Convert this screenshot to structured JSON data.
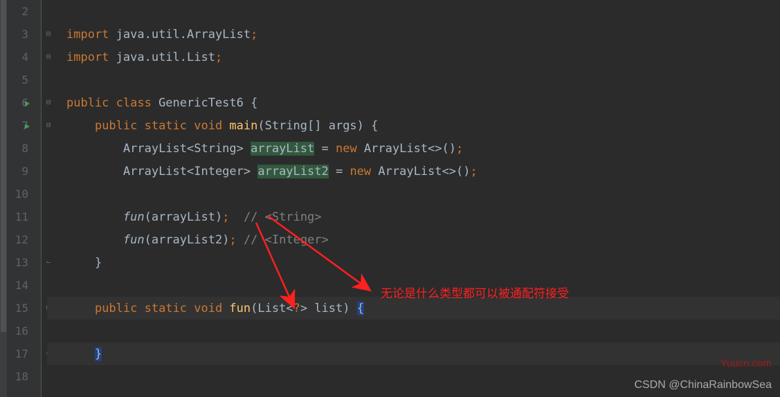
{
  "gutter": {
    "start": 2,
    "end": 18,
    "run_markers": [
      6,
      7
    ]
  },
  "fold": {
    "open_rows": [
      3,
      4,
      6,
      7,
      15
    ],
    "close_rows": [
      13,
      17
    ]
  },
  "code": {
    "l3": {
      "kw1": "import ",
      "pkg": "java.util.ArrayList",
      "semi": ";"
    },
    "l4": {
      "kw1": "import ",
      "pkg": "java.util.List",
      "semi": ";"
    },
    "l6": {
      "kw1": "public class ",
      "name": "GenericTest6 ",
      "brace": "{"
    },
    "l7": {
      "kw1": "public static void ",
      "method": "main",
      "sig": "(String[] args) {"
    },
    "l8": {
      "t1": "ArrayList<String> ",
      "var": "arrayList",
      "eq": " = ",
      "kw": "new ",
      "t2": "ArrayList<>()",
      "semi": ";"
    },
    "l9": {
      "t1": "ArrayList<Integer> ",
      "var": "arrayList2",
      "eq": " = ",
      "kw": "new ",
      "t2": "ArrayList<>()",
      "semi": ";"
    },
    "l11": {
      "fn": "fun",
      "args": "(arrayList)",
      "semi": ";",
      "sp": "  ",
      "cm": "// <String>"
    },
    "l12": {
      "fn": "fun",
      "args": "(arrayList2)",
      "semi": ";",
      "sp": " ",
      "cm": "// <Integer>"
    },
    "l13": {
      "brace": "}"
    },
    "l15": {
      "kw1": "public static void ",
      "method": "fun",
      "p1": "(List<",
      "wild": "?",
      "p2": "> list) ",
      "brace": "{"
    },
    "l17": {
      "brace": "}"
    }
  },
  "annotation": {
    "text": "无论是什么类型都可以被通配符接受"
  },
  "watermarks": {
    "w1": "Yuucn.com",
    "w2": "CSDN @ChinaRainbowSea"
  }
}
